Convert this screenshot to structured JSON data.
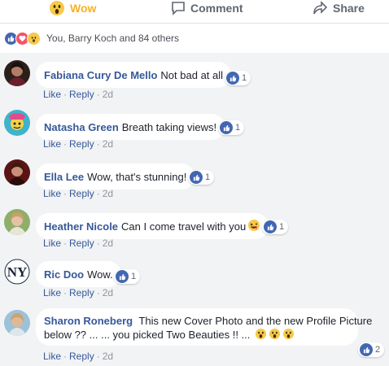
{
  "actions": {
    "wow_label": "Wow",
    "comment_label": "Comment",
    "share_label": "Share"
  },
  "reactions_summary": {
    "text": "You, Barry Koch and 84 others"
  },
  "comment_meta": {
    "like_label": "Like",
    "reply_label": "Reply",
    "separator": "·"
  },
  "comments": [
    {
      "author": "Fabiana Cury De Mello",
      "text": "Not bad at all",
      "likes": "1",
      "time": "2d"
    },
    {
      "author": "Natasha Green",
      "text": "Breath taking views!",
      "likes": "1",
      "time": "2d"
    },
    {
      "author": "Ella Lee",
      "text": "Wow, that's stunning!",
      "likes": "1",
      "time": "2d"
    },
    {
      "author": "Heather Nicole",
      "text": "Can I come travel with you",
      "likes": "1",
      "time": "2d"
    },
    {
      "author": "Ric Doo",
      "text": "Wow.",
      "likes": "1",
      "time": "2d"
    },
    {
      "author": "Sharon Roneberg",
      "text_line1": "This new Cover Photo and the new Profile Picture",
      "text_line2": "below ?? ... ... you picked Two Beauties !! ...",
      "likes": "2",
      "time": "2d"
    }
  ],
  "colors": {
    "link": "#365899",
    "wow_accent": "#f7b125",
    "like_blue": "#4267b2",
    "background": "#f2f3f5"
  }
}
